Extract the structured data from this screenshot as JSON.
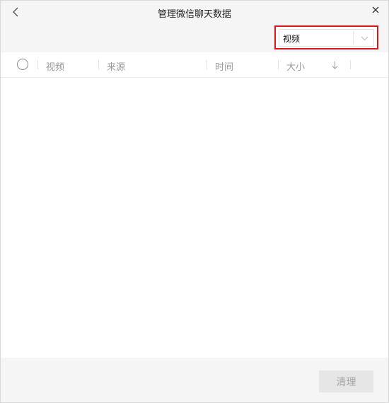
{
  "window": {
    "title": "管理微信聊天数据"
  },
  "filter": {
    "selected": "视频",
    "highlight_color": "#e0161d"
  },
  "table": {
    "columns": [
      "视频",
      "来源",
      "时间",
      "大小"
    ],
    "sort_icon": "arrow-down-icon",
    "rows": []
  },
  "footer": {
    "clear_label": "清理"
  },
  "icons": {
    "back": "chevron-left-icon",
    "close": "close-icon",
    "dropdown": "chevron-down-icon"
  }
}
